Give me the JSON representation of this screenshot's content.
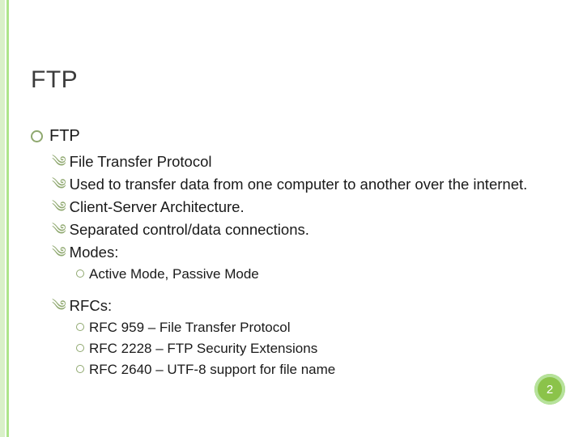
{
  "title": "FTP",
  "section_heading": "FTP",
  "points_a": [
    "File Transfer Protocol",
    "Used to transfer data from one computer to another over the internet.",
    "Client-Server Architecture.",
    "Separated control/data connections.",
    "Modes:"
  ],
  "modes_sub": [
    "Active Mode, Passive Mode"
  ],
  "rfcs_label": "RFCs:",
  "rfcs_sub": [
    "RFC 959 – File Transfer Protocol",
    "RFC 2228 – FTP Security Extensions",
    "RFC 2640 – UTF-8 support for file name"
  ],
  "page_number": "2"
}
